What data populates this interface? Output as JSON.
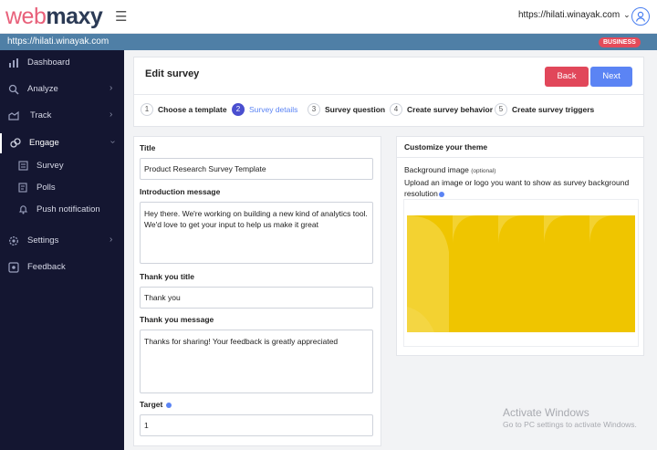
{
  "brand": {
    "logo_part1": "web",
    "logo_part2": "maxy",
    "menu_icon": "hamburger-icon"
  },
  "header": {
    "site_selector": "https://hilati.winayak.com",
    "avatar_icon": "user-avatar-icon"
  },
  "urlbar": {
    "url": "https://hilati.winayak.com",
    "badge": "BUSINESS"
  },
  "sidebar": {
    "items": [
      {
        "label": "Dashboard",
        "icon": "bar-chart-icon"
      },
      {
        "label": "Analyze",
        "icon": "analyze-icon"
      },
      {
        "label": "Track",
        "icon": "track-icon"
      },
      {
        "label": "Engage",
        "icon": "engage-icon"
      },
      {
        "label": "Settings",
        "icon": "gear-icon"
      },
      {
        "label": "Feedback",
        "icon": "feedback-icon"
      }
    ],
    "subitems": [
      {
        "label": "Survey",
        "icon": "survey-icon"
      },
      {
        "label": "Polls",
        "icon": "polls-icon"
      },
      {
        "label": "Push notification",
        "icon": "bell-icon"
      }
    ]
  },
  "page": {
    "title": "Edit survey",
    "back_label": "Back",
    "next_label": "Next",
    "steps": [
      {
        "num": "1",
        "label": "Choose a template"
      },
      {
        "num": "2",
        "label": "Survey details"
      },
      {
        "num": "3",
        "label": "Survey question"
      },
      {
        "num": "4",
        "label": "Create survey behavior"
      },
      {
        "num": "5",
        "label": "Create survey triggers"
      }
    ]
  },
  "form": {
    "title_label": "Title",
    "title_value": "Product Research Survey Template",
    "intro_label": "Introduction message",
    "intro_value": "Hey there. We're working on building a new kind of analytics tool. We'd love to get your input to help us make it great",
    "thanks_title_label": "Thank you title",
    "thanks_title_value": "Thank you",
    "thanks_msg_label": "Thank you message",
    "thanks_msg_value": "Thanks for sharing! Your feedback is greatly appreciated",
    "target_label": "Target",
    "target_value": "1"
  },
  "theme": {
    "title": "Customize your theme",
    "bg_label": "Background image",
    "bg_optional": "(optional)",
    "bg_desc": "Upload an image or logo you want to show as survey background resolution",
    "colors": {
      "primary": "#efc500",
      "light": "#f6dc5a"
    }
  },
  "watermark": {
    "line1": "Activate Windows",
    "line2": "Go to PC settings to activate Windows."
  }
}
